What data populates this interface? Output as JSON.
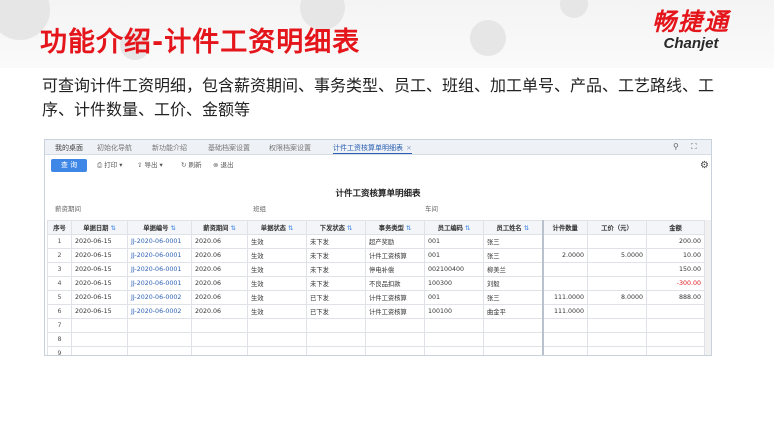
{
  "slide": {
    "title": "功能介绍-计件工资明细表",
    "logo_cn": "畅捷通",
    "logo_en": "Chanjet",
    "description": "可查询计件工资明细，包含薪资期间、事务类型、员工、班组、加工单号、产品、工艺路线、工序、计件数量、工价、金额等"
  },
  "app": {
    "tabs": [
      {
        "label": "我的桌面"
      },
      {
        "label": "初始化导航"
      },
      {
        "label": "新功能介绍"
      },
      {
        "label": "基础档案设置"
      },
      {
        "label": "权限档案设置"
      },
      {
        "label": "计件工资核算单明细表",
        "close": "×"
      }
    ],
    "window_controls": {
      "search": "⚲",
      "restore": "⛶"
    },
    "toolbar": {
      "query": "查 询",
      "print": "打印",
      "export": "导出",
      "refresh": "刷新",
      "exit": "退出",
      "settings_icon": "gear-icon"
    },
    "report": {
      "title": "计件工资核算单明细表",
      "filters": {
        "period": "薪资期间",
        "team": "班组",
        "workshop": "车间"
      }
    },
    "table": {
      "columns": [
        "序号",
        "单据日期",
        "单据编号",
        "薪资期间",
        "单据状态",
        "下发状态",
        "事务类型",
        "员工编码",
        "员工姓名",
        "计件数量",
        "工价（元）",
        "金额"
      ],
      "rows": [
        {
          "no": "1",
          "date": "2020-06-15",
          "code": "JJ-2020-06-0001",
          "period": "2020.06",
          "status": "生效",
          "dispatch": "未下发",
          "type": "超产奖励",
          "emp_code": "001",
          "emp_name": "张三",
          "qty": "",
          "price": "",
          "amount": "200.00",
          "neg": false
        },
        {
          "no": "2",
          "date": "2020-06-15",
          "code": "JJ-2020-06-0001",
          "period": "2020.06",
          "status": "生效",
          "dispatch": "未下发",
          "type": "计件工资核算",
          "emp_code": "001",
          "emp_name": "张三",
          "qty": "2.0000",
          "price": "5.0000",
          "amount": "10.00",
          "neg": false
        },
        {
          "no": "3",
          "date": "2020-06-15",
          "code": "JJ-2020-06-0001",
          "period": "2020.06",
          "status": "生效",
          "dispatch": "未下发",
          "type": "停电补偿",
          "emp_code": "002100400",
          "emp_name": "柳美兰",
          "qty": "",
          "price": "",
          "amount": "150.00",
          "neg": false
        },
        {
          "no": "4",
          "date": "2020-06-15",
          "code": "JJ-2020-06-0001",
          "period": "2020.06",
          "status": "生效",
          "dispatch": "未下发",
          "type": "不良品扣款",
          "emp_code": "100300",
          "emp_name": "刘毅",
          "qty": "",
          "price": "",
          "amount": "-300.00",
          "neg": true
        },
        {
          "no": "5",
          "date": "2020-06-15",
          "code": "JJ-2020-06-0002",
          "period": "2020.06",
          "status": "生效",
          "dispatch": "已下发",
          "type": "计件工资核算",
          "emp_code": "001",
          "emp_name": "张三",
          "qty": "111.0000",
          "price": "8.0000",
          "amount": "888.00",
          "neg": false
        },
        {
          "no": "6",
          "date": "2020-06-15",
          "code": "JJ-2020-06-0002",
          "period": "2020.06",
          "status": "生效",
          "dispatch": "已下发",
          "type": "计件工资核算",
          "emp_code": "100100",
          "emp_name": "曲金平",
          "qty": "111.0000",
          "price": "",
          "amount": "",
          "neg": false
        },
        {
          "no": "7",
          "date": "",
          "code": "",
          "period": "",
          "status": "",
          "dispatch": "",
          "type": "",
          "emp_code": "",
          "emp_name": "",
          "qty": "",
          "price": "",
          "amount": "",
          "neg": false
        },
        {
          "no": "8",
          "date": "",
          "code": "",
          "period": "",
          "status": "",
          "dispatch": "",
          "type": "",
          "emp_code": "",
          "emp_name": "",
          "qty": "",
          "price": "",
          "amount": "",
          "neg": false
        },
        {
          "no": "9",
          "date": "",
          "code": "",
          "period": "",
          "status": "",
          "dispatch": "",
          "type": "",
          "emp_code": "",
          "emp_name": "",
          "qty": "",
          "price": "",
          "amount": "",
          "neg": false
        }
      ]
    }
  },
  "colors": {
    "brand_red": "#e4151b",
    "link_blue": "#2a5fb3",
    "button_blue": "#3f87e6"
  }
}
